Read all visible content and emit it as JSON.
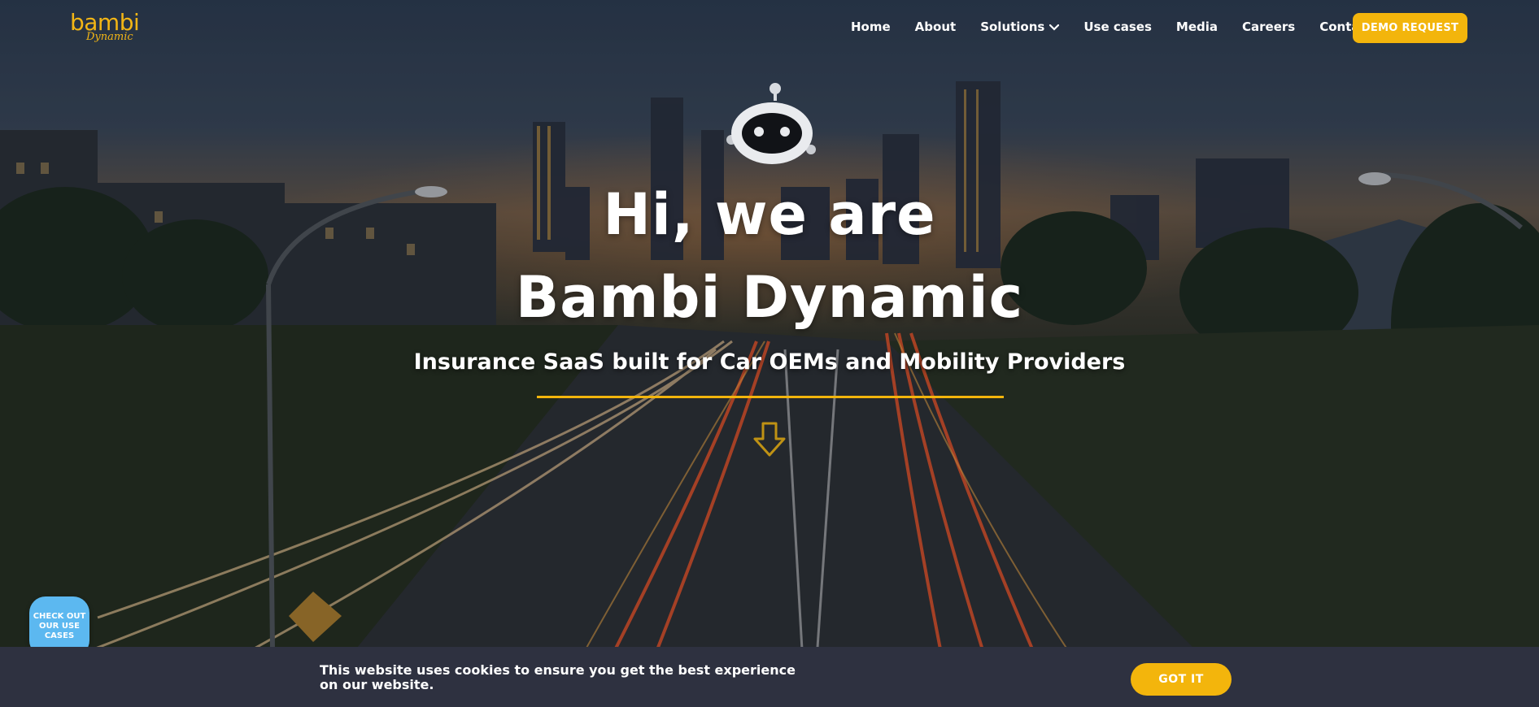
{
  "brand": {
    "name": "bambi",
    "sub": "Dynamic",
    "color": "#f2b515"
  },
  "nav": {
    "items": [
      {
        "label": "Home"
      },
      {
        "label": "About"
      },
      {
        "label": "Solutions",
        "has_dropdown": true
      },
      {
        "label": "Use cases"
      },
      {
        "label": "Media"
      },
      {
        "label": "Careers"
      },
      {
        "label": "Contact us"
      }
    ],
    "demo_button": "DEMO REQUEST"
  },
  "hero": {
    "line1": "Hi, we are",
    "line2": "Bambi Dynamic",
    "tagline": "Insurance SaaS built for Car OEMs and Mobility Providers",
    "accent_color": "#f3b50c",
    "icons": [
      "robot-mascot-icon",
      "arrow-down-icon"
    ]
  },
  "floating_badge": {
    "label": "CHECK OUT OUR USE CASES",
    "color": "#5cb8f0"
  },
  "cookie_bar": {
    "text": "This website uses cookies to ensure you get the best experience on our website.",
    "button": "GOT IT"
  }
}
